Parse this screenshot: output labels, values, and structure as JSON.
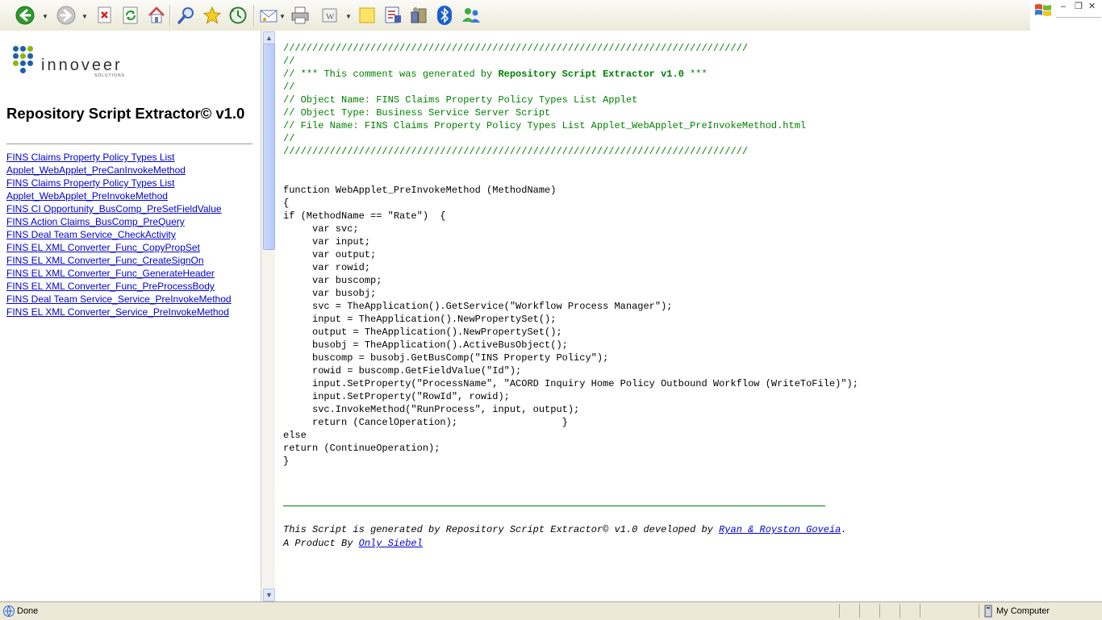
{
  "toolbar": {
    "buttons": [
      {
        "name": "back-button",
        "icon": "back-arrow-icon"
      },
      {
        "name": "forward-button",
        "icon": "forward-arrow-icon"
      },
      {
        "name": "stop-button",
        "icon": "stop-icon"
      },
      {
        "name": "refresh-button",
        "icon": "refresh-icon"
      },
      {
        "name": "home-button",
        "icon": "home-icon"
      },
      {
        "name": "search-button",
        "icon": "search-icon"
      },
      {
        "name": "favorites-button",
        "icon": "star-icon"
      },
      {
        "name": "history-button",
        "icon": "history-icon"
      },
      {
        "name": "mail-button",
        "icon": "mail-icon"
      },
      {
        "name": "print-button",
        "icon": "printer-icon"
      },
      {
        "name": "edit-button",
        "icon": "edit-icon"
      },
      {
        "name": "notes-button",
        "icon": "note-icon"
      },
      {
        "name": "research-button",
        "icon": "research-icon"
      },
      {
        "name": "tools-button",
        "icon": "tools-icon"
      },
      {
        "name": "bluetooth-button",
        "icon": "bluetooth-icon"
      },
      {
        "name": "messenger-button",
        "icon": "messenger-icon"
      }
    ],
    "accent_green": "#2e9a2e",
    "accent_blue": "#1a5fd0"
  },
  "logo": {
    "word": "innoveer",
    "sub": "SOLUTIONS",
    "dot_colors": [
      "#1f5fa8",
      "#8cb800"
    ]
  },
  "left": {
    "title": "Repository Script Extractor© v1.0",
    "links": [
      "FINS Claims Property Policy Types List",
      "Applet_WebApplet_PreCanInvokeMethod",
      "FINS Claims Property Policy Types List",
      "Applet_WebApplet_PreInvokeMethod",
      "FINS CI Opportunity_BusComp_PreSetFieldValue",
      "FINS Action Claims_BusComp_PreQuery",
      "FINS Deal Team Service_CheckActivity",
      "FINS EL XML Converter_Func_CopyPropSet",
      "FINS EL XML Converter_Func_CreateSignOn",
      "FINS EL XML Converter_Func_GenerateHeader",
      "FINS EL XML Converter_Func_PreProcessBody",
      "FINS Deal Team Service_Service_PreInvokeMethod",
      "FINS EL XML Converter_Service_PreInvokeMethod"
    ]
  },
  "script": {
    "comment_lines": [
      "////////////////////////////////////////////////////////////////////////////////",
      "//",
      "// *** This comment was generated by ",
      "//",
      "// Object Name: FINS Claims Property Policy Types List Applet",
      "// Object Type: Business Service Server Script",
      "// File Name: FINS Claims Property Policy Types List Applet_WebApplet_PreInvokeMethod.html",
      "//",
      "////////////////////////////////////////////////////////////////////////////////"
    ],
    "generator_name": "Repository Script Extractor v1.0",
    "generator_suffix": " ***",
    "code_lines": [
      "function WebApplet_PreInvokeMethod (MethodName)",
      "{",
      "if (MethodName == \"Rate\")  {",
      "     var svc;",
      "     var input;",
      "     var output;",
      "     var rowid;",
      "     var buscomp;",
      "     var busobj;",
      "     svc = TheApplication().GetService(\"Workflow Process Manager\");",
      "     input = TheApplication().NewPropertySet();",
      "     output = TheApplication().NewPropertySet();",
      "     busobj = TheApplication().ActiveBusObject();",
      "     buscomp = busobj.GetBusComp(\"INS Property Policy\");",
      "     rowid = buscomp.GetFieldValue(\"Id\");",
      "     input.SetProperty(\"ProcessName\", \"ACORD Inquiry Home Policy Outbound Workflow (WriteToFile)\");",
      "     input.SetProperty(\"RowId\", rowid);",
      "     svc.InvokeMethod(\"RunProcess\", input, output);",
      "     return (CancelOperation);                  }",
      "else",
      "return (ContinueOperation);",
      "}"
    ],
    "comment_color": "#008000"
  },
  "footer": {
    "line1_prefix": "This Script is generated by Repository Script Extractor© v1.0 developed by ",
    "line1_link": "Ryan & Royston Goveia",
    "line1_suffix": ".",
    "line2_prefix": "A Product By ",
    "line2_link": "Only Siebel"
  },
  "status": {
    "left_text": "Done",
    "right_text": "My Computer"
  }
}
